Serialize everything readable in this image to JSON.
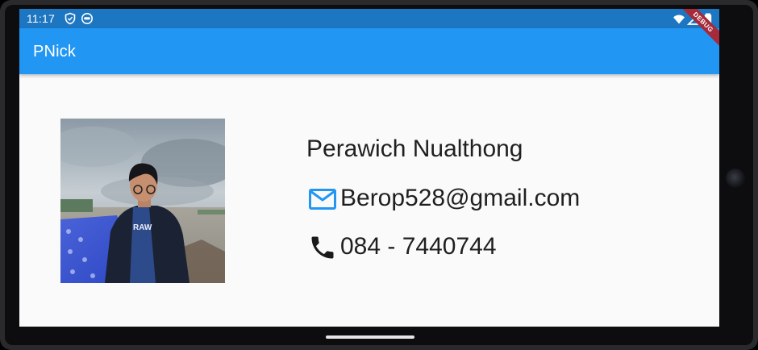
{
  "status_bar": {
    "time": "11:17",
    "icons": [
      "shield-icon",
      "face-icon",
      "wifi-icon",
      "signal-icon",
      "battery-icon"
    ]
  },
  "app_bar": {
    "title": "PNick",
    "color": "#2196f3",
    "status_color": "#1d76c2"
  },
  "debug_banner": "DEBUG",
  "profile": {
    "name": "Perawich Nualthong",
    "email": "Berop528@gmail.com",
    "phone": "084 - 7440744",
    "photo_icon": "profile-photo",
    "email_icon": "mail-icon",
    "phone_icon": "phone-icon",
    "email_icon_color": "#2196f3"
  }
}
